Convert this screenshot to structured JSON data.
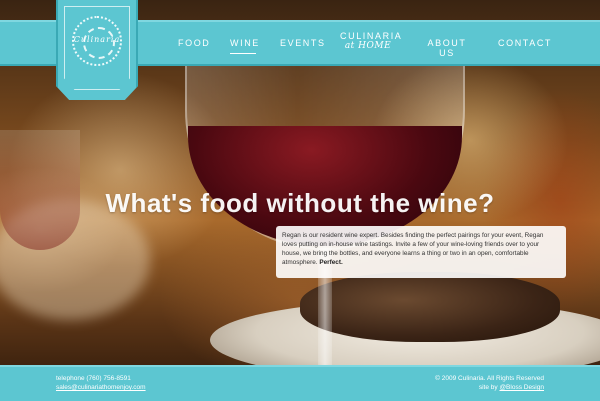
{
  "brand": {
    "logo_text": "Culinaria"
  },
  "nav": {
    "items": [
      {
        "label": "FOOD"
      },
      {
        "label": "WINE"
      },
      {
        "label": "EVENTS"
      },
      {
        "label": "CULINARIA",
        "sub": "at HOME"
      },
      {
        "label": "ABOUT US"
      },
      {
        "label": "CONTACT"
      }
    ],
    "active": "WINE"
  },
  "hero": {
    "headline": "What's food without the wine?",
    "body": "Regan is our resident wine expert. Besides finding the perfect pairings for your event, Regan loves putting on in-house wine tastings. Invite a few of your wine-loving friends over to your house, we bring the bottles, and everyone learns a thing or two in an open, comfortable atmosphere.",
    "emphasis": "Perfect."
  },
  "footer": {
    "telephone_label": "telephone",
    "telephone": "(760) 756-8591",
    "email": "sales@culinariathomenjoy.com",
    "copyright": "© 2009 Culinaria. All Rights Reserved",
    "credit_prefix": "site by",
    "credit_link": "@Bloss Design"
  },
  "colors": {
    "accent": "#5cc6d1",
    "accent_dark": "#3aa9b5",
    "text_light": "#ffffff"
  }
}
